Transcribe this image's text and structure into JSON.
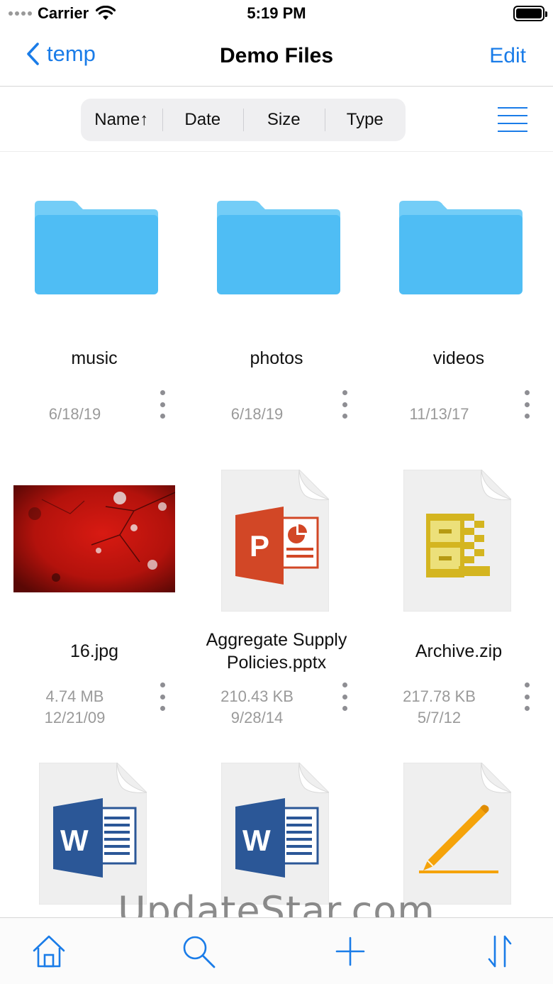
{
  "status_bar": {
    "carrier": "Carrier",
    "time": "5:19 PM"
  },
  "nav": {
    "back_label": "temp",
    "title": "Demo Files",
    "edit_label": "Edit"
  },
  "sort": {
    "name": "Name↑",
    "date": "Date",
    "size": "Size",
    "type": "Type"
  },
  "folders": [
    {
      "name": "music",
      "date": "6/18/19"
    },
    {
      "name": "photos",
      "date": "6/18/19"
    },
    {
      "name": "videos",
      "date": "11/13/17"
    }
  ],
  "files": [
    {
      "name": "16.jpg",
      "size": "4.74 MB",
      "date": "12/21/09",
      "kind": "image"
    },
    {
      "name_line1": "Aggregate Supply",
      "name_line2": "Policies.pptx",
      "size": "210.43 KB",
      "date": "9/28/14",
      "kind": "powerpoint"
    },
    {
      "name": "Archive.zip",
      "size": "217.78 KB",
      "date": "5/7/12",
      "kind": "zip"
    }
  ],
  "partial_files": [
    {
      "kind": "word"
    },
    {
      "kind": "word"
    },
    {
      "kind": "pages"
    }
  ],
  "watermark": "UpdateStar.com",
  "colors": {
    "accent": "#1a7ce8",
    "folder": "#4fbdf4",
    "folder_tab": "#73cdf7",
    "ppt": "#d24726",
    "word": "#2b5797",
    "zip": "#d4b520",
    "pen": "#f5a30a"
  },
  "tab_icons": [
    "home-icon",
    "search-icon",
    "plus-icon",
    "sort-icon"
  ]
}
